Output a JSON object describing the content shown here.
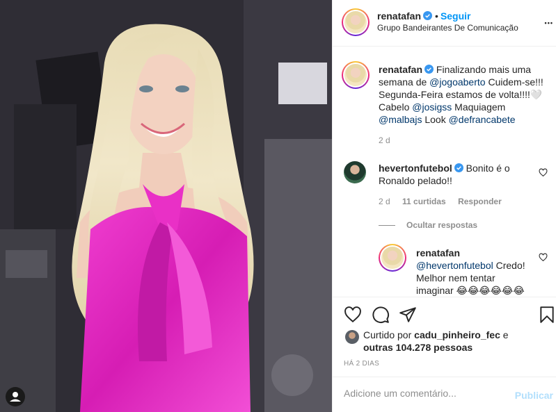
{
  "post": {
    "author": "renatafan",
    "follow_label": "Seguir",
    "follow_sep": "•",
    "location": "Grupo Bandeirantes De Comunicação",
    "more_label": "•••"
  },
  "caption": {
    "author": "renatafan",
    "text_1": "Finalizando mais uma semana de ",
    "mention_1": "@jogoaberto",
    "text_2": " Cuidem-se!!! Segunda-Feira estamos de volta!!!!🤍 Cabelo ",
    "mention_2": "@josigss",
    "text_3": " Maquiagem ",
    "mention_3": "@malbajs",
    "text_4": " Look ",
    "mention_4": "@defrancabete",
    "time": "2 d"
  },
  "comment_1": {
    "author": "hevertonfutebol",
    "text": "Bonito é o Ronaldo pelado!!",
    "time": "2 d",
    "likes": "11 curtidas",
    "reply": "Responder",
    "hide_replies": "Ocultar respostas"
  },
  "reply_1": {
    "author": "renatafan",
    "mention": "@hevertonfutebol",
    "text": " Credo! Melhor nem tentar imaginar 😂😂😂😂😂😂"
  },
  "likes": {
    "prefix": "Curtido por ",
    "user": "cadu_pinheiro_fec",
    "middle": " e",
    "others": "outras 104.278 pessoas"
  },
  "date": "HÁ 2 DIAS",
  "add_comment": {
    "placeholder": "Adicione um comentário...",
    "publish": "Publicar"
  },
  "colors": {
    "accent": "#0095f6",
    "mention": "#00376b",
    "publish_disabled": "#b2dffc",
    "dress": "#e325c0"
  },
  "icons": [
    "heart-icon",
    "comment-icon",
    "share-icon",
    "bookmark-icon",
    "verified-badge-icon",
    "user-tag-icon",
    "more-options-icon"
  ]
}
